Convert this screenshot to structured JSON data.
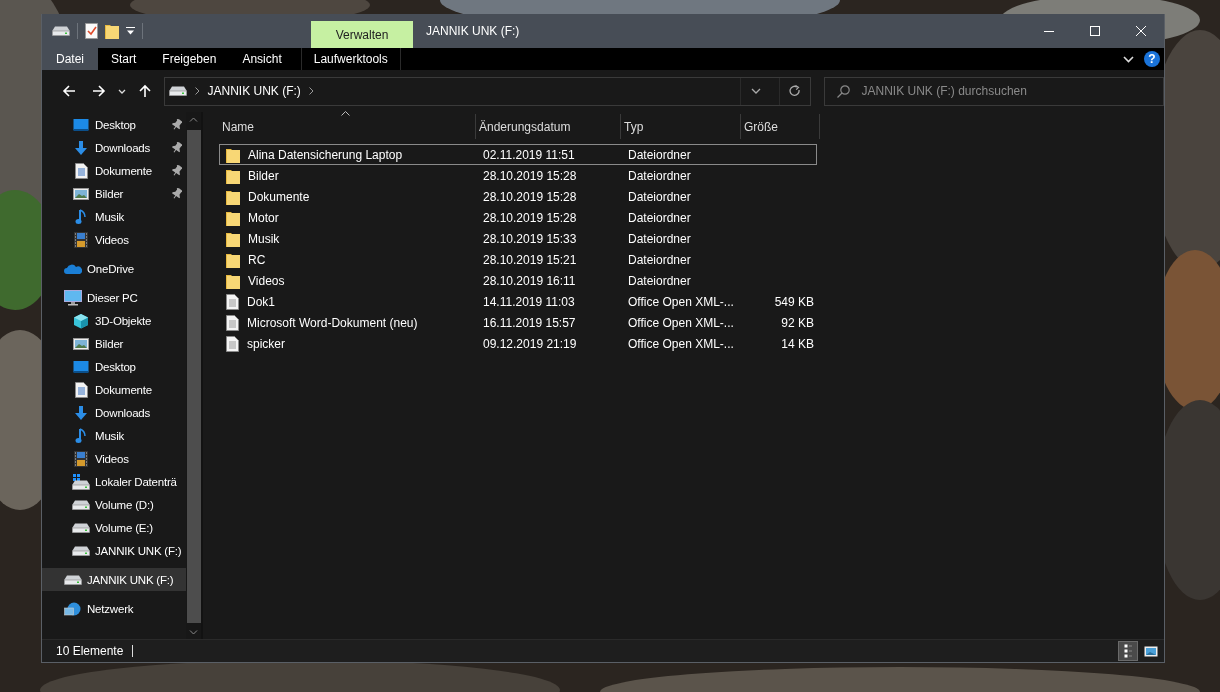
{
  "window": {
    "title": "JANNIK UNK (F:)"
  },
  "quick_access_toolbar": [
    {
      "kind": "drive"
    },
    {
      "kind": "properties"
    },
    {
      "kind": "folder"
    },
    {
      "kind": "customize"
    }
  ],
  "ribbon": {
    "context_tab": "Verwalten",
    "help": "?",
    "tabs": [
      {
        "label": "Datei",
        "selected": true
      },
      {
        "label": "Start",
        "selected": false
      },
      {
        "label": "Freigeben",
        "selected": false
      },
      {
        "label": "Ansicht",
        "selected": false
      },
      {
        "label": "Laufwerktools",
        "selected": false,
        "contextual": true
      }
    ]
  },
  "address_bar": {
    "path": [
      "JANNIK UNK (F:)"
    ]
  },
  "search": {
    "placeholder": "JANNIK UNK (F:) durchsuchen"
  },
  "sidebar": {
    "quick_access": [
      {
        "label": "Desktop",
        "kind": "desktop",
        "pinned": true,
        "selected": false
      },
      {
        "label": "Downloads",
        "kind": "download",
        "pinned": true,
        "selected": false
      },
      {
        "label": "Dokumente",
        "kind": "documents",
        "pinned": true,
        "selected": false
      },
      {
        "label": "Bilder",
        "kind": "pictures",
        "pinned": true,
        "selected": false
      },
      {
        "label": "Musik",
        "kind": "music",
        "pinned": false,
        "selected": false
      },
      {
        "label": "Videos",
        "kind": "videos",
        "pinned": false,
        "selected": false
      }
    ],
    "items": [
      {
        "label": "OneDrive",
        "kind": "onedrive",
        "selected": false
      },
      {
        "label": "Dieser PC",
        "kind": "pc",
        "selected": false,
        "children": [
          {
            "label": "3D-Objekte",
            "kind": "cube",
            "selected": false
          },
          {
            "label": "Bilder",
            "kind": "pictures",
            "selected": false
          },
          {
            "label": "Desktop",
            "kind": "desktop",
            "selected": false
          },
          {
            "label": "Dokumente",
            "kind": "documents",
            "selected": false
          },
          {
            "label": "Downloads",
            "kind": "download",
            "selected": false
          },
          {
            "label": "Musik",
            "kind": "music",
            "selected": false
          },
          {
            "label": "Videos",
            "kind": "videos",
            "selected": false
          },
          {
            "label": "Lokaler Datenträ",
            "kind": "windrive",
            "selected": false
          },
          {
            "label": "Volume (D:)",
            "kind": "drive",
            "selected": false
          },
          {
            "label": "Volume (E:)",
            "kind": "drive",
            "selected": false
          },
          {
            "label": "JANNIK UNK (F:)",
            "kind": "drive",
            "selected": false
          }
        ]
      },
      {
        "label": "JANNIK UNK (F:)",
        "kind": "drive",
        "selected": true
      },
      {
        "label": "Netzwerk",
        "kind": "network",
        "selected": false
      }
    ]
  },
  "table": {
    "columns": [
      {
        "label": "Name",
        "sorted": true
      },
      {
        "label": "Änderungsdatum",
        "sorted": false
      },
      {
        "label": "Typ",
        "sorted": false
      },
      {
        "label": "Größe",
        "sorted": false
      }
    ],
    "rows": [
      {
        "kind": "folder",
        "name": "Alina Datensicherung Laptop",
        "date": "02.11.2019 11:51",
        "type": "Dateiordner",
        "focused": true
      },
      {
        "kind": "folder",
        "name": "Bilder",
        "date": "28.10.2019 15:28",
        "type": "Dateiordner",
        "focused": false
      },
      {
        "kind": "folder",
        "name": "Dokumente",
        "date": "28.10.2019 15:28",
        "type": "Dateiordner",
        "focused": false
      },
      {
        "kind": "folder",
        "name": "Motor",
        "date": "28.10.2019 15:28",
        "type": "Dateiordner",
        "focused": false
      },
      {
        "kind": "folder",
        "name": "Musik",
        "date": "28.10.2019 15:33",
        "type": "Dateiordner",
        "focused": false
      },
      {
        "kind": "folder",
        "name": "RC",
        "date": "28.10.2019 15:21",
        "type": "Dateiordner",
        "focused": false
      },
      {
        "kind": "folder",
        "name": "Videos",
        "date": "28.10.2019 16:11",
        "type": "Dateiordner",
        "focused": false
      },
      {
        "kind": "file",
        "name": "Dok1",
        "date": "14.11.2019 11:03",
        "type": "Office Open XML-...",
        "size": "549 KB",
        "focused": false
      },
      {
        "kind": "file",
        "name": "Microsoft Word-Dokument (neu)",
        "date": "16.11.2019 15:57",
        "type": "Office Open XML-...",
        "size": "92 KB",
        "focused": false
      },
      {
        "kind": "file",
        "name": "spicker",
        "date": "09.12.2019 21:19",
        "type": "Office Open XML-...",
        "size": "14 KB",
        "focused": false
      }
    ]
  },
  "status_bar": {
    "text": "10 Elemente",
    "views": [
      {
        "kind": "details",
        "selected": true
      },
      {
        "kind": "large_icons",
        "selected": false
      }
    ]
  }
}
